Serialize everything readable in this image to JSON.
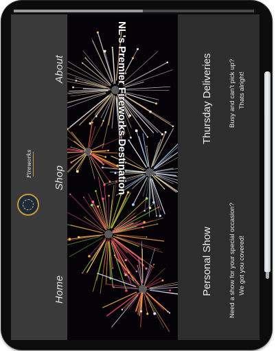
{
  "nav": {
    "about": "About",
    "shop": "Shop",
    "home": "Home",
    "brand_text": "Fireworks"
  },
  "hero": {
    "title": "NL's Premier Fireworks Destination"
  },
  "sections": {
    "thursday": {
      "heading": "Thursday Deliveries",
      "line1": "Busy and can't pick up?",
      "line2": "Thats alright!"
    },
    "personal": {
      "heading": "Personal Show",
      "line1": "Need a show for your special occasion?",
      "line2": "We got you covered!"
    }
  },
  "colors": {
    "nav_bg": "#3a3a3a",
    "content_bg": "#2d2d2d",
    "accent_gold": "#c79a3b"
  }
}
